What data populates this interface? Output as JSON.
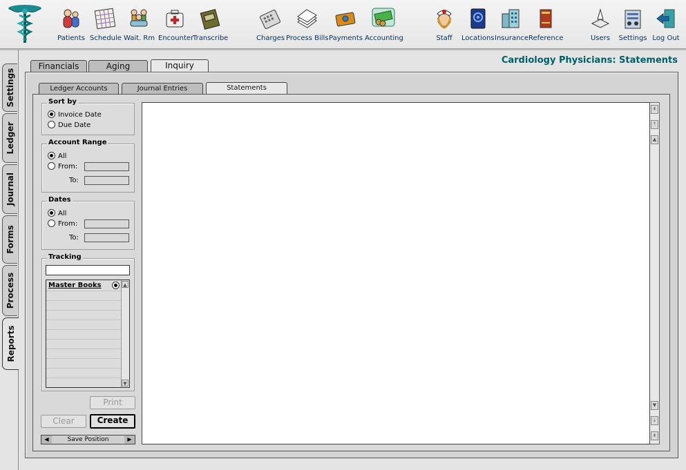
{
  "toolbar": {
    "groups": [
      {
        "items": [
          {
            "id": "patients",
            "label": "Patients",
            "icon": "patients-icon"
          },
          {
            "id": "schedule",
            "label": "Schedule",
            "icon": "calendar-icon"
          },
          {
            "id": "waiting",
            "label": "Wait. Rm",
            "icon": "waiting-room-icon"
          },
          {
            "id": "encounter",
            "label": "Encounter",
            "icon": "medical-kit-icon"
          },
          {
            "id": "transcribe",
            "label": "Transcribe",
            "icon": "tape-recorder-icon"
          }
        ]
      },
      {
        "items": [
          {
            "id": "charges",
            "label": "Charges",
            "icon": "calculator-icon"
          },
          {
            "id": "process-bills",
            "label": "Process Bills",
            "icon": "paper-stack-icon"
          },
          {
            "id": "payments",
            "label": "Payments",
            "icon": "payment-card-icon"
          },
          {
            "id": "accounting",
            "label": "Accounting",
            "icon": "money-icon"
          }
        ]
      },
      {
        "items": [
          {
            "id": "staff",
            "label": "Staff",
            "icon": "nurse-icon"
          },
          {
            "id": "locations",
            "label": "Locations",
            "icon": "address-book-icon"
          },
          {
            "id": "insurance",
            "label": "Insurance",
            "icon": "buildings-icon"
          },
          {
            "id": "reference",
            "label": "Reference",
            "icon": "books-icon"
          }
        ]
      },
      {
        "items": [
          {
            "id": "users",
            "label": "Users",
            "icon": "users-icon"
          },
          {
            "id": "settings",
            "label": "Settings",
            "icon": "settings-icon"
          },
          {
            "id": "logout",
            "label": "Log Out",
            "icon": "logout-door-icon"
          }
        ]
      }
    ]
  },
  "side_tabs": [
    "Settings",
    "Ledger",
    "Journal",
    "Forms",
    "Process",
    "Reports"
  ],
  "page_title": "Cardiology Physicians: Statements",
  "main_tabs": [
    "Financials",
    "Aging",
    "Inquiry"
  ],
  "sub_tabs": [
    "Ledger Accounts",
    "Journal Entries",
    "Statements"
  ],
  "sort_by": {
    "title": "Sort by",
    "options": [
      "Invoice Date",
      "Due Date"
    ],
    "selected": 0
  },
  "account_range": {
    "title": "Account Range",
    "all_label": "All",
    "from_label": "From:",
    "to_label": "To:"
  },
  "dates": {
    "title": "Dates",
    "all_label": "All",
    "from_label": "From:",
    "to_label": "To:"
  },
  "tracking": {
    "title": "Tracking",
    "input_value": "",
    "list_items": [
      "Master Books"
    ]
  },
  "buttons": {
    "print": "Print",
    "clear": "Clear",
    "create": "Create",
    "save_position": "Save Position"
  },
  "colors": {
    "title_teal": "#00606a",
    "toolbar_label": "#00305a"
  }
}
